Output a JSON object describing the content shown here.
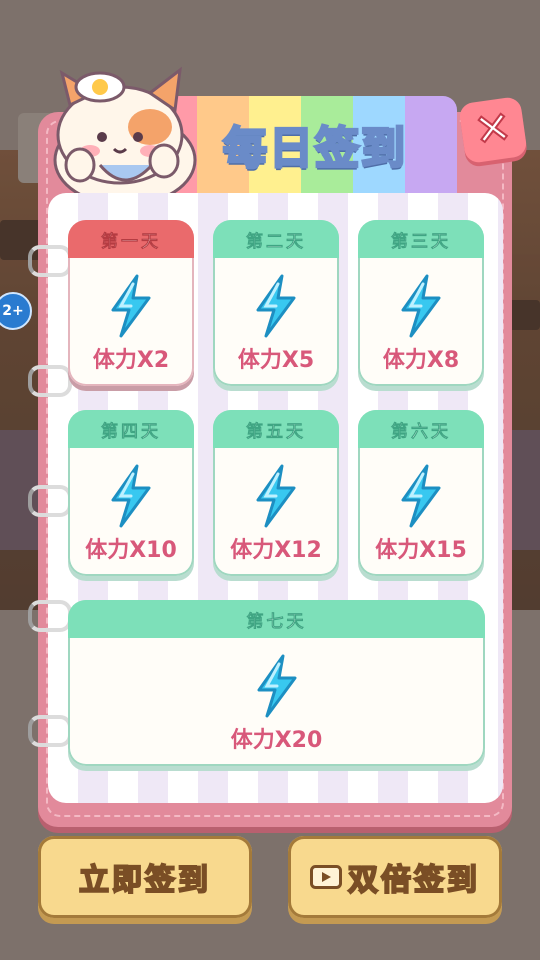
{
  "title": "每日签到",
  "close_label": "✕",
  "level_badge": "2+",
  "days": [
    {
      "head": "第一天",
      "reward": "体力X2",
      "active": true
    },
    {
      "head": "第二天",
      "reward": "体力X5",
      "active": false
    },
    {
      "head": "第三天",
      "reward": "体力X8",
      "active": false
    },
    {
      "head": "第四天",
      "reward": "体力X10",
      "active": false
    },
    {
      "head": "第五天",
      "reward": "体力X12",
      "active": false
    },
    {
      "head": "第六天",
      "reward": "体力X15",
      "active": false
    },
    {
      "head": "第七天",
      "reward": "体力X20",
      "active": false
    }
  ],
  "buttons": {
    "sign_in": "立即签到",
    "double_sign_in": "双倍签到"
  },
  "icons": {
    "reward": "lightning-bolt-icon",
    "close": "close-icon",
    "video": "video-play-icon"
  },
  "colors": {
    "panel": "#e28a9b",
    "active_head": "#ea6a6c",
    "head": "#7de0b9",
    "reward_text": "#d8587a",
    "button": "#f8d98e"
  }
}
